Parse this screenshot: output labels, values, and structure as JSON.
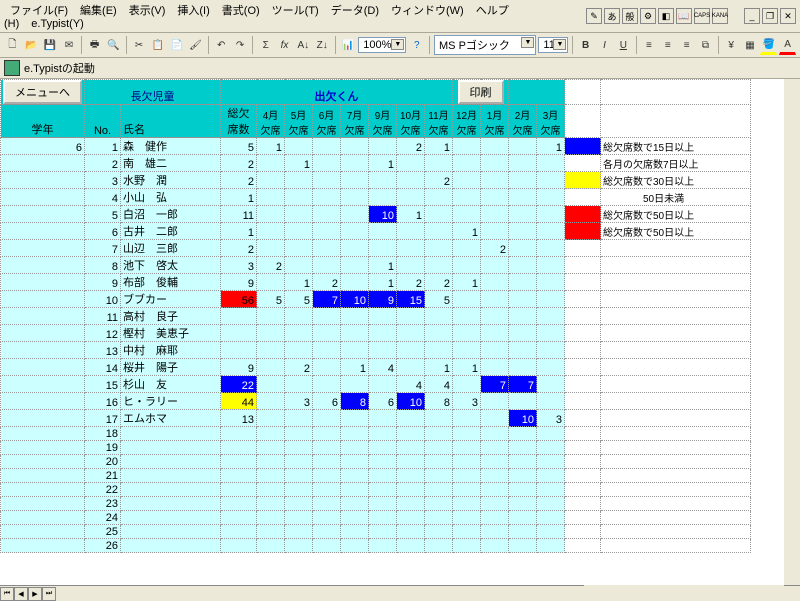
{
  "menus": [
    "ファイル(F)",
    "編集(E)",
    "表示(V)",
    "挿入(I)",
    "書式(O)",
    "ツール(T)",
    "データ(D)",
    "ウィンドウ(W)",
    "ヘルプ(H)",
    "e.Typist(Y)"
  ],
  "ime": {
    "lang": "あ",
    "mode": "般",
    "caps": "CAPS",
    "kana": "KANA"
  },
  "toolbar": {
    "zoom": "100%",
    "font": "MS Pゴシック",
    "fontsize": "11"
  },
  "launch": "e.Typistの起動",
  "header": {
    "menu_btn": "メニューへ",
    "sub_title": "長欠児童",
    "app_title": "出欠くん",
    "print_btn": "印刷",
    "cols_main": [
      "学年",
      "No.",
      "氏名",
      "総欠\n席数"
    ],
    "months": [
      "4月\n欠席",
      "5月\n欠席",
      "6月\n欠席",
      "7月\n欠席",
      "9月\n欠席",
      "10月\n欠席",
      "11月\n欠席",
      "12月\n欠席",
      "1月\n欠席",
      "2月\n欠席",
      "3月\n欠席"
    ]
  },
  "rows": [
    {
      "g": "6",
      "n": "1",
      "name": "森　健作",
      "t": "5",
      "m": [
        "1",
        "",
        "",
        "",
        "",
        "2",
        "1",
        "",
        "",
        "",
        "1"
      ]
    },
    {
      "g": "",
      "n": "2",
      "name": "南　雄二",
      "t": "2",
      "m": [
        "",
        "1",
        "",
        "",
        "1",
        "",
        "",
        "",
        "",
        "",
        ""
      ]
    },
    {
      "g": "",
      "n": "3",
      "name": "水野　潤",
      "t": "2",
      "m": [
        "",
        "",
        "",
        "",
        "",
        "",
        "2",
        "",
        "",
        "",
        ""
      ]
    },
    {
      "g": "",
      "n": "4",
      "name": "小山　弘",
      "t": "1",
      "m": [
        "",
        "",
        "",
        "",
        "",
        "",
        "",
        "",
        "",
        "",
        ""
      ]
    },
    {
      "g": "",
      "n": "5",
      "name": "白沼　一郎",
      "t": "11",
      "m": [
        "",
        "",
        "",
        "",
        "10",
        "1",
        "",
        "",
        "",
        "",
        ""
      ],
      "hl": {
        "4": "blue"
      }
    },
    {
      "g": "",
      "n": "6",
      "name": "古井　二郎",
      "t": "1",
      "m": [
        "",
        "",
        "",
        "",
        "",
        "",
        "",
        "1",
        "",
        "",
        ""
      ]
    },
    {
      "g": "",
      "n": "7",
      "name": "山辺　三郎",
      "t": "2",
      "m": [
        "",
        "",
        "",
        "",
        "",
        "",
        "",
        "",
        "2",
        "",
        ""
      ]
    },
    {
      "g": "",
      "n": "8",
      "name": "池下　啓太",
      "t": "3",
      "m": [
        "2",
        "",
        "",
        "",
        "1",
        "",
        "",
        "",
        "",
        "",
        ""
      ]
    },
    {
      "g": "",
      "n": "9",
      "name": "布部　俊輔",
      "t": "9",
      "m": [
        "",
        "1",
        "2",
        "",
        "1",
        "2",
        "2",
        "1",
        "",
        "",
        ""
      ]
    },
    {
      "g": "",
      "n": "10",
      "name": "ブブカー",
      "t": "56",
      "m": [
        "5",
        "5",
        "7",
        "10",
        "9",
        "15",
        "5",
        "",
        "",
        "",
        ""
      ],
      "thl": "red",
      "hl": {
        "2": "blue",
        "3": "blue",
        "4": "blue",
        "5": "blue"
      }
    },
    {
      "g": "",
      "n": "11",
      "name": "高村　良子",
      "t": "",
      "m": [
        "",
        "",
        "",
        "",
        "",
        "",
        "",
        "",
        "",
        "",
        ""
      ]
    },
    {
      "g": "",
      "n": "12",
      "name": "樫村　美恵子",
      "t": "",
      "m": [
        "",
        "",
        "",
        "",
        "",
        "",
        "",
        "",
        "",
        "",
        ""
      ]
    },
    {
      "g": "",
      "n": "13",
      "name": "中村　麻耶",
      "t": "",
      "m": [
        "",
        "",
        "",
        "",
        "",
        "",
        "",
        "",
        "",
        "",
        ""
      ]
    },
    {
      "g": "",
      "n": "14",
      "name": "桜井　陽子",
      "t": "9",
      "m": [
        "",
        "2",
        "",
        "1",
        "4",
        "",
        "1",
        "1",
        "",
        "",
        ""
      ]
    },
    {
      "g": "",
      "n": "15",
      "name": "杉山　友",
      "t": "22",
      "m": [
        "",
        "",
        "",
        "",
        "",
        "4",
        "4",
        "",
        "7",
        "7",
        ""
      ],
      "thl": "blue",
      "hl": {
        "8": "blue",
        "9": "blue"
      }
    },
    {
      "g": "",
      "n": "16",
      "name": "ヒ・ラリー",
      "t": "44",
      "m": [
        "",
        "3",
        "6",
        "8",
        "6",
        "10",
        "8",
        "3",
        "",
        "",
        ""
      ],
      "thl": "yellow",
      "hl": {
        "3": "blue",
        "5": "blue"
      }
    },
    {
      "g": "",
      "n": "17",
      "name": "エムホマ",
      "t": "13",
      "m": [
        "",
        "",
        "",
        "",
        "",
        "",
        "",
        "",
        "",
        "10",
        "3"
      ],
      "hl": {
        "9": "blue"
      }
    },
    {
      "g": "",
      "n": "18",
      "name": "",
      "t": "",
      "m": [
        "",
        "",
        "",
        "",
        "",
        "",
        "",
        "",
        "",
        "",
        ""
      ]
    },
    {
      "g": "",
      "n": "19",
      "name": "",
      "t": "",
      "m": [
        "",
        "",
        "",
        "",
        "",
        "",
        "",
        "",
        "",
        "",
        ""
      ]
    },
    {
      "g": "",
      "n": "20",
      "name": "",
      "t": "",
      "m": [
        "",
        "",
        "",
        "",
        "",
        "",
        "",
        "",
        "",
        "",
        ""
      ]
    },
    {
      "g": "",
      "n": "21",
      "name": "",
      "t": "",
      "m": [
        "",
        "",
        "",
        "",
        "",
        "",
        "",
        "",
        "",
        "",
        ""
      ]
    },
    {
      "g": "",
      "n": "22",
      "name": "",
      "t": "",
      "m": [
        "",
        "",
        "",
        "",
        "",
        "",
        "",
        "",
        "",
        "",
        ""
      ]
    },
    {
      "g": "",
      "n": "23",
      "name": "",
      "t": "",
      "m": [
        "",
        "",
        "",
        "",
        "",
        "",
        "",
        "",
        "",
        "",
        ""
      ]
    },
    {
      "g": "",
      "n": "24",
      "name": "",
      "t": "",
      "m": [
        "",
        "",
        "",
        "",
        "",
        "",
        "",
        "",
        "",
        "",
        ""
      ]
    },
    {
      "g": "",
      "n": "25",
      "name": "",
      "t": "",
      "m": [
        "",
        "",
        "",
        "",
        "",
        "",
        "",
        "",
        "",
        "",
        ""
      ]
    },
    {
      "g": "",
      "n": "26",
      "name": "",
      "t": "",
      "m": [
        "",
        "",
        "",
        "",
        "",
        "",
        "",
        "",
        "",
        "",
        ""
      ]
    }
  ],
  "legend": [
    {
      "color": "blue",
      "text": "総欠席数で15日以上"
    },
    {
      "color": "",
      "text": "各月の欠席数7日以上"
    },
    {
      "color": "yellow",
      "text": "総欠席数で30日以上"
    },
    {
      "color": "",
      "text": "　　　　50日未満"
    },
    {
      "color": "red",
      "text": "総欠席数で50日以上"
    }
  ]
}
